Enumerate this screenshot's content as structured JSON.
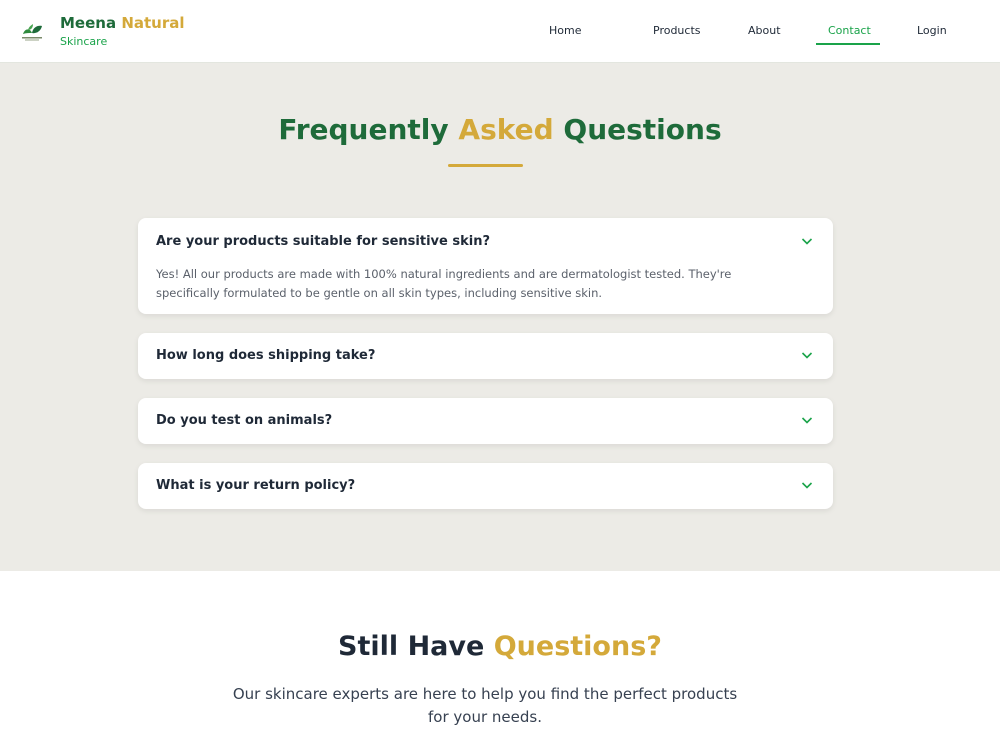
{
  "brand": {
    "name_part1": "Meena",
    "name_part2": "Natural",
    "tagline": "Skincare",
    "logo_icon": "leaf-logo-icon"
  },
  "nav": {
    "items": [
      {
        "label": "Home"
      },
      {
        "label": "Products"
      },
      {
        "label": "About"
      },
      {
        "label": "Contact",
        "active": true
      },
      {
        "label": "Login"
      }
    ]
  },
  "faq": {
    "title_part1": "Frequently",
    "title_part2": "Asked",
    "title_part3": "Questions",
    "items": [
      {
        "question": "Are your products suitable for sensitive skin?",
        "answer": "Yes! All our products are made with 100% natural ingredients and are dermatologist tested. They're specifically formulated to be gentle on all skin types, including sensitive skin.",
        "expanded": true
      },
      {
        "question": "How long does shipping take?",
        "expanded": false
      },
      {
        "question": "Do you test on animals?",
        "expanded": false
      },
      {
        "question": "What is your return policy?",
        "expanded": false
      }
    ]
  },
  "contact": {
    "title_part1": "Still Have",
    "title_part2": "Questions?",
    "text": "Our skincare experts are here to help you find the perfect products for your needs."
  },
  "colors": {
    "primary_green": "#1e6b3a",
    "accent_green": "#1aa34a",
    "gold": "#d4a93a",
    "section_bg": "#ecebe6"
  }
}
